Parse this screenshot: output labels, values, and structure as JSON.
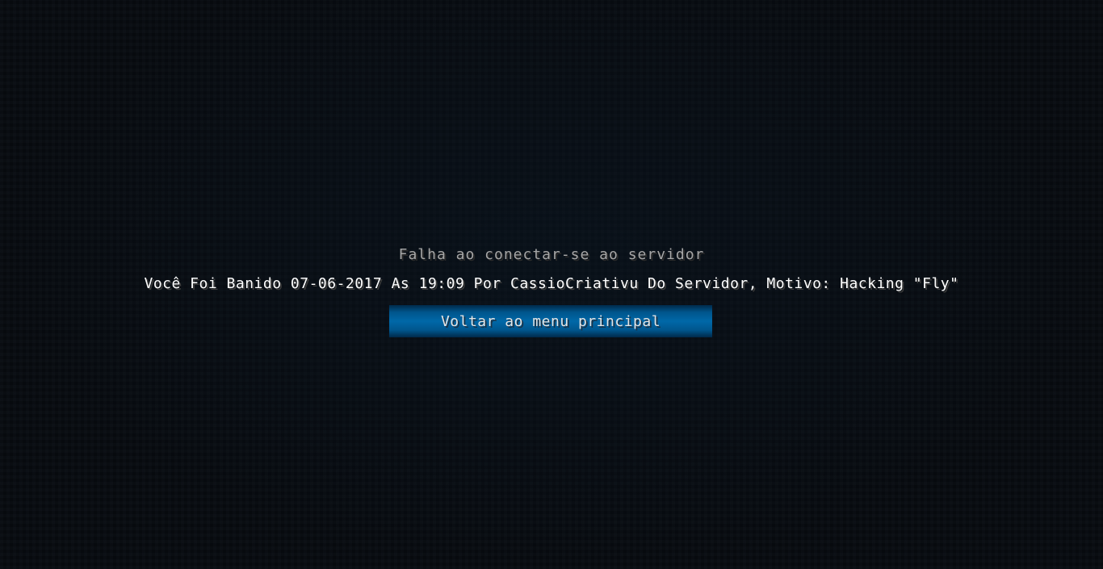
{
  "disconnect_screen": {
    "title": "Falha ao conectar-se ao servidor",
    "reason": "Você Foi Banido 07-06-2017 As 19:09 Por CassioCriativu Do Servidor, Motivo: Hacking \"Fly\"",
    "back_button_label": "Voltar ao menu principal"
  },
  "colors": {
    "background": "#070b10",
    "title_text": "#a6a6a6",
    "reason_text": "#ffffff",
    "button_accent": "#0068a8",
    "button_text": "#e4e4e4"
  }
}
